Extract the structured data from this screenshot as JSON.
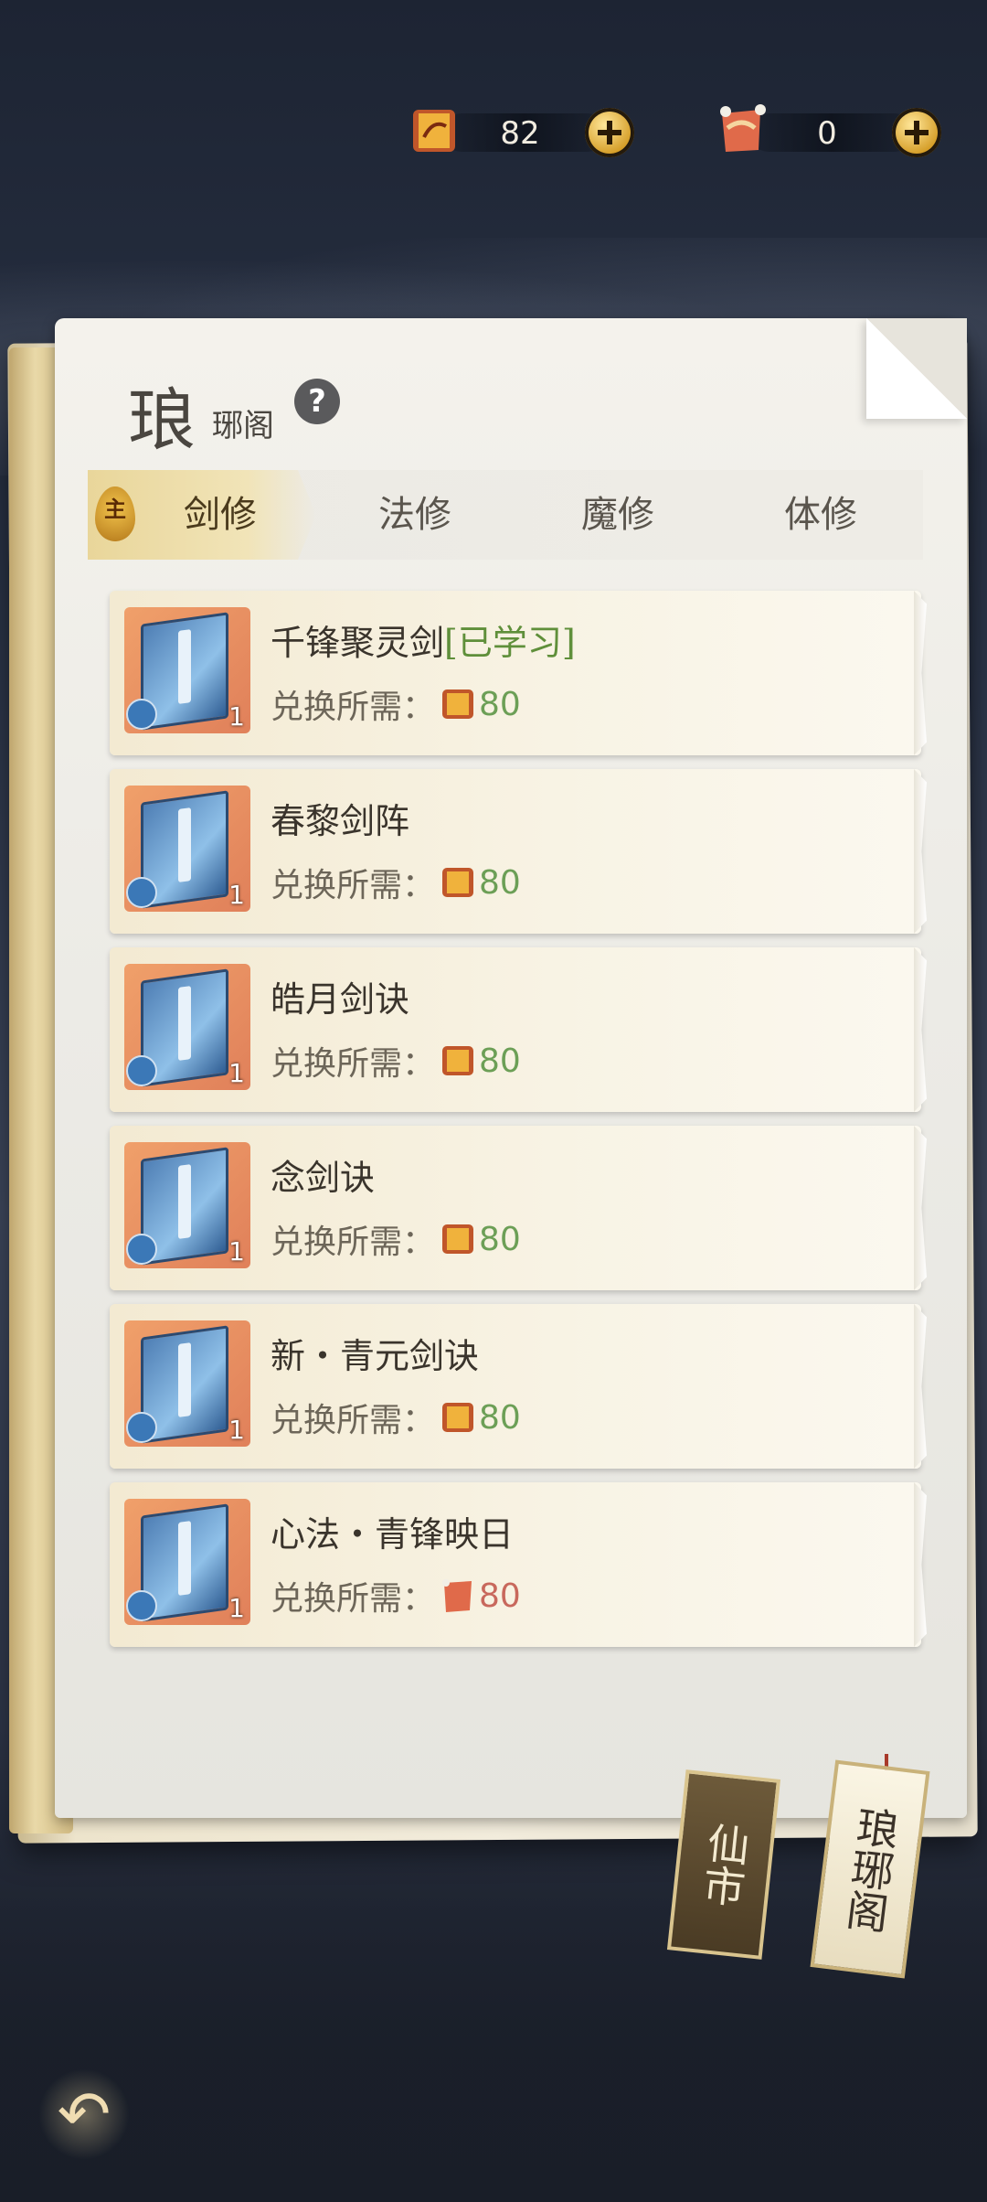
{
  "currency": [
    {
      "name": "scroll-currency-icon",
      "value": "82"
    },
    {
      "name": "token-currency-icon",
      "value": "0"
    }
  ],
  "title": {
    "big": "琅",
    "small": "琊阁"
  },
  "tabs": {
    "badge": "主",
    "items": [
      {
        "label": "剑修"
      },
      {
        "label": "法修"
      },
      {
        "label": "魔修"
      },
      {
        "label": "体修"
      }
    ]
  },
  "items": [
    {
      "name": "千锋聚灵剑",
      "status": "[已学习]",
      "level": "1",
      "cost_label": "兑换所需：",
      "cost": "80",
      "cost_icon": "scroll-currency-icon",
      "color": "#6c9f56"
    },
    {
      "name": "春黎剑阵",
      "status": "",
      "level": "1",
      "cost_label": "兑换所需：",
      "cost": "80",
      "cost_icon": "scroll-currency-icon",
      "color": "#6c9f56"
    },
    {
      "name": "皓月剑诀",
      "status": "",
      "level": "1",
      "cost_label": "兑换所需：",
      "cost": "80",
      "cost_icon": "scroll-currency-icon",
      "color": "#6c9f56"
    },
    {
      "name": "念剑诀",
      "status": "",
      "level": "1",
      "cost_label": "兑换所需：",
      "cost": "80",
      "cost_icon": "scroll-currency-icon",
      "color": "#6c9f56"
    },
    {
      "name": "新・青元剑诀",
      "status": "",
      "level": "1",
      "cost_label": "兑换所需：",
      "cost": "80",
      "cost_icon": "scroll-currency-icon",
      "color": "#6c9f56"
    },
    {
      "name": "心法・青锋映日",
      "status": "",
      "level": "1",
      "cost_label": "兑换所需：",
      "cost": "80",
      "cost_icon": "token-currency-icon",
      "color": "#c8685c"
    }
  ],
  "bookmarks": [
    {
      "label": "仙市"
    },
    {
      "label": "琅琊阁"
    }
  ],
  "back_icon": "undo-arrow-icon"
}
